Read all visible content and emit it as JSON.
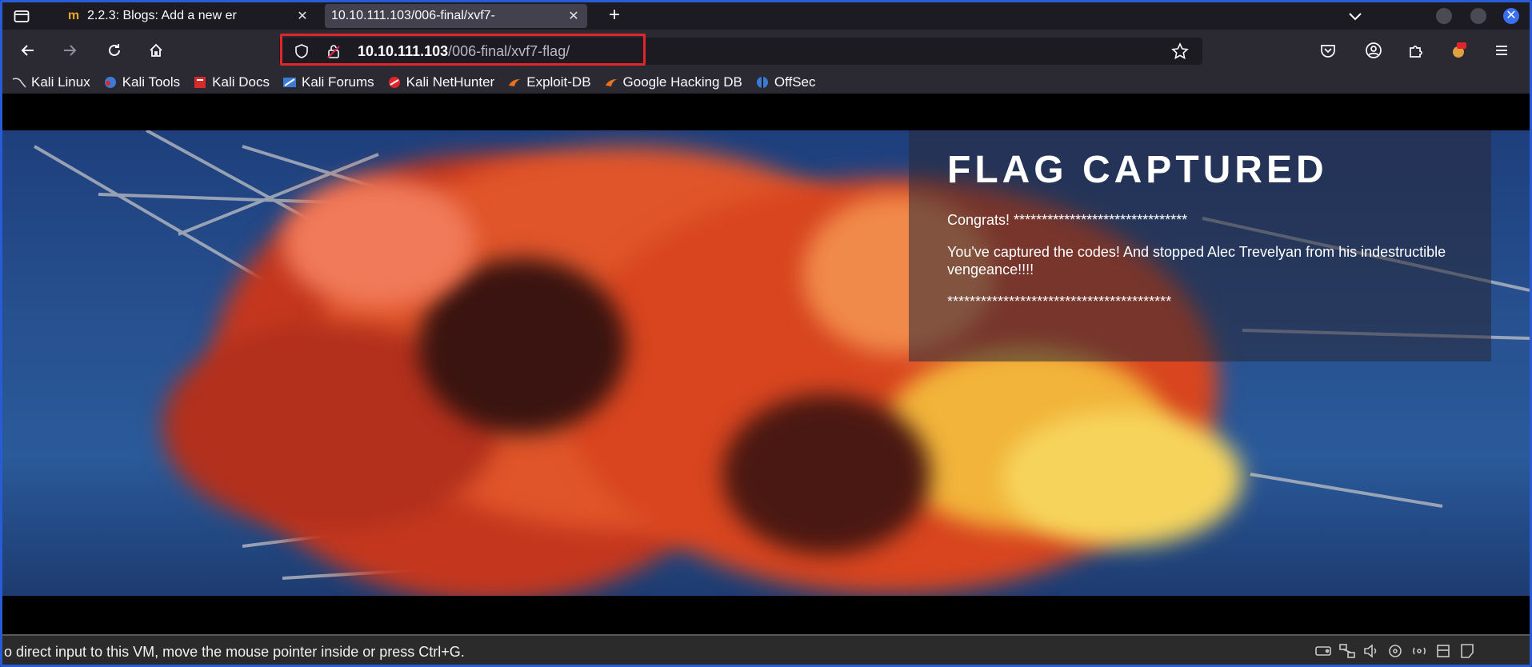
{
  "tabs": [
    {
      "favicon": "moodle-icon",
      "label": "2.2.3: Blogs: Add a new er",
      "active": false
    },
    {
      "favicon": "",
      "label": "10.10.111.103/006-final/xvf7-",
      "active": true
    }
  ],
  "urlbar": {
    "host": "10.10.111.103",
    "path": "/006-final/xvf7-flag/"
  },
  "bookmarks": [
    {
      "label": "Kali Linux",
      "icon": "kali-dragon-icon"
    },
    {
      "label": "Kali Tools",
      "icon": "kali-tools-icon"
    },
    {
      "label": "Kali Docs",
      "icon": "kali-docs-icon"
    },
    {
      "label": "Kali Forums",
      "icon": "kali-forums-icon"
    },
    {
      "label": "Kali NetHunter",
      "icon": "nethunter-icon"
    },
    {
      "label": "Exploit-DB",
      "icon": "exploit-db-icon"
    },
    {
      "label": "Google Hacking DB",
      "icon": "ghdb-icon"
    },
    {
      "label": "OffSec",
      "icon": "offsec-icon"
    }
  ],
  "page": {
    "title": "FLAG CAPTURED",
    "line1": "Congrats! *******************************",
    "line2": "You've captured the codes! And stopped Alec Trevelyan from his indestructible vengeance!!!!",
    "line3": "****************************************"
  },
  "statusbar": {
    "text": "o direct input to this VM, move the mouse pointer inside or press Ctrl+G."
  },
  "colors": {
    "accent": "#3b6ff2",
    "highlight_border": "#e0262b"
  }
}
